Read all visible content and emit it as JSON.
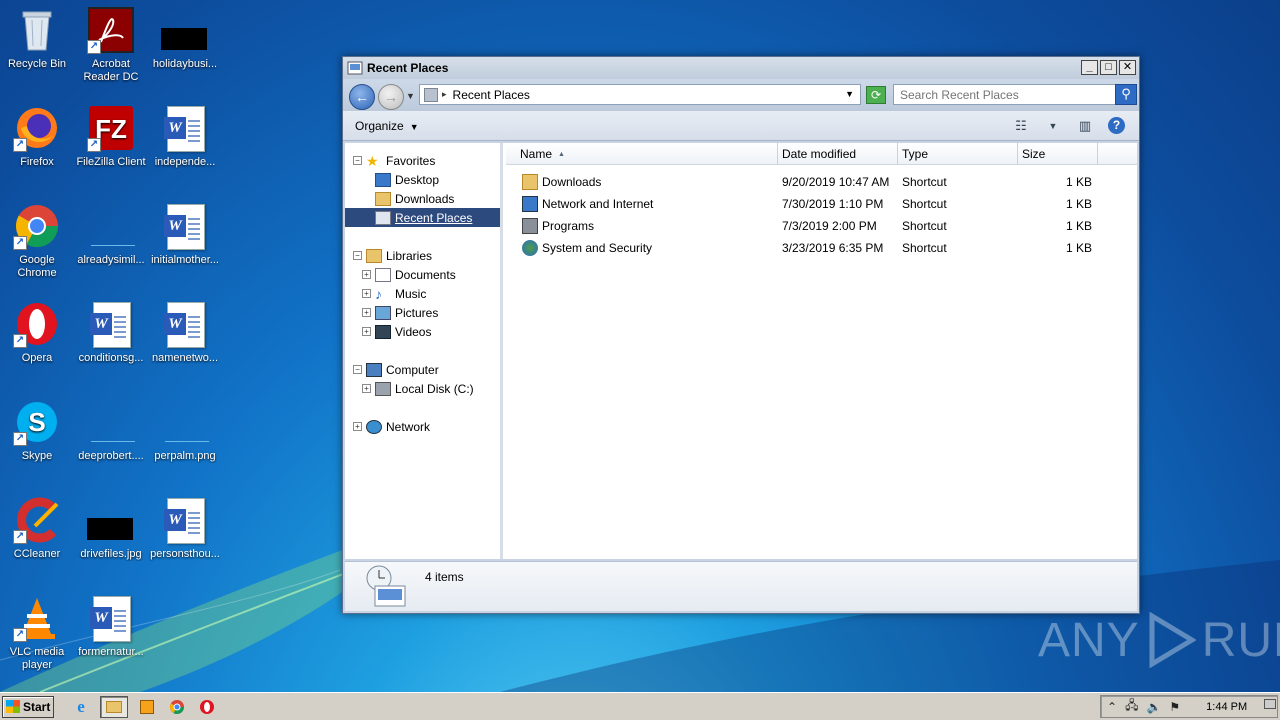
{
  "desktop": {
    "icons": [
      {
        "label": "Recycle Bin"
      },
      {
        "label": "Acrobat Reader DC"
      },
      {
        "label": "holidaybusi..."
      },
      {
        "label": "Firefox"
      },
      {
        "label": "FileZilla Client"
      },
      {
        "label": "independe..."
      },
      {
        "label": "Google Chrome"
      },
      {
        "label": "alreadysimil..."
      },
      {
        "label": "initialmother..."
      },
      {
        "label": "Opera"
      },
      {
        "label": "conditionsg..."
      },
      {
        "label": "namenetwo..."
      },
      {
        "label": "Skype"
      },
      {
        "label": "deeprobert...."
      },
      {
        "label": "perpalm.png"
      },
      {
        "label": "CCleaner"
      },
      {
        "label": "drivefiles.jpg"
      },
      {
        "label": "personsthou..."
      },
      {
        "label": "VLC media player"
      },
      {
        "label": "formernatur..."
      }
    ]
  },
  "window": {
    "title": "Recent Places",
    "address": "Recent Places",
    "search_placeholder": "Search Recent Places",
    "toolbar": {
      "organize": "Organize"
    },
    "nav": {
      "favorites": "Favorites",
      "desktop": "Desktop",
      "downloads": "Downloads",
      "recent_places": "Recent Places",
      "libraries": "Libraries",
      "documents": "Documents",
      "music": "Music",
      "pictures": "Pictures",
      "videos": "Videos",
      "computer": "Computer",
      "local_disk": "Local Disk (C:)",
      "network": "Network"
    },
    "columns": {
      "name": "Name",
      "date": "Date modified",
      "type": "Type",
      "size": "Size"
    },
    "files": [
      {
        "name": "Downloads",
        "date": "9/20/2019 10:47 AM",
        "type": "Shortcut",
        "size": "1 KB"
      },
      {
        "name": "Network and Internet",
        "date": "7/30/2019 1:10 PM",
        "type": "Shortcut",
        "size": "1 KB"
      },
      {
        "name": "Programs",
        "date": "7/3/2019 2:00 PM",
        "type": "Shortcut",
        "size": "1 KB"
      },
      {
        "name": "System and Security",
        "date": "3/23/2019 6:35 PM",
        "type": "Shortcut",
        "size": "1 KB"
      }
    ],
    "status": "4 items"
  },
  "taskbar": {
    "start": "Start",
    "clock": "1:44 PM"
  },
  "watermark": {
    "left": "ANY",
    "right": "RUN"
  },
  "colors": {
    "selection": "#2d4a7f",
    "accent": "#2e6bc4"
  }
}
